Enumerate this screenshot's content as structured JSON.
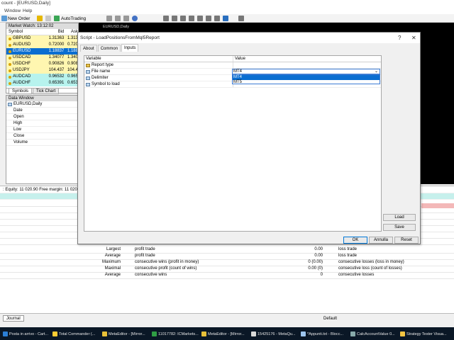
{
  "window": {
    "title": "count - [EURUSD,Daily]",
    "menu": [
      "Window",
      "Help"
    ]
  },
  "toolbar": {
    "new_order": "New Order",
    "auto_trading": "AutoTrading"
  },
  "market_watch": {
    "title": "Market Watch: 13:12:02",
    "col_symbol": "Symbol",
    "col_bid": "Bid",
    "col_ask": "Ask",
    "rows": [
      {
        "symbol": "GBPUSD",
        "bid": "1.31363",
        "ask": "1.313",
        "bg": "#fff6b0"
      },
      {
        "symbol": "AUDUSD",
        "bid": "0.72000",
        "ask": "0.720",
        "bg": "#fff6b0"
      },
      {
        "symbol": "EURUSD",
        "bid": "1.18837",
        "ask": "1.188",
        "bg": "#0a6ed1",
        "fg": "#ffffff"
      },
      {
        "symbol": "USDCAD",
        "bid": "1.34077",
        "ask": "1.340",
        "bg": "#fff6b0"
      },
      {
        "symbol": "USDCHF",
        "bid": "0.90826",
        "ask": "0.908",
        "bg": "#fff6b0"
      },
      {
        "symbol": "USDJPY",
        "bid": "104.437",
        "ask": "104.4",
        "bg": "#fff6b0"
      },
      {
        "symbol": "AUDCAD",
        "bid": "0.96532",
        "ask": "0.965",
        "bg": "#b7f3ee"
      },
      {
        "symbol": "AUDCHF",
        "bid": "0.65391",
        "ask": "0.653",
        "bg": "#b7f3ee"
      }
    ],
    "tabs": [
      "Symbols",
      "Tick Chart"
    ]
  },
  "data_window": {
    "title": "Data Window",
    "symbol": "EURUSD,Daily",
    "rows": [
      "Date",
      "Open",
      "High",
      "Low",
      "Close",
      "Volume"
    ]
  },
  "chart": {
    "label": "EURUSD,Daily"
  },
  "status": {
    "equity_line": ": Equity: 11 020.90  Free margin: 11 020.90"
  },
  "report": {
    "rows": [
      {
        "a": "Largest",
        "b": "profit trade",
        "c": "0.00",
        "d": "loss trade"
      },
      {
        "a": "Average",
        "b": "profit trade",
        "c": "0.00",
        "d": "loss trade"
      },
      {
        "a": "Maximum",
        "b": "consecutive wins (profit in money)",
        "c": "0 (0.00)",
        "d": "consecutive losses (loss in money)"
      },
      {
        "a": "Maximal",
        "b": "consecutive profit (count of wins)",
        "c": "0.00 (0)",
        "d": "consecutive loss (count of losses)"
      },
      {
        "a": "Average",
        "b": "consecutive wins",
        "c": "0",
        "d": "consecutive losses"
      }
    ]
  },
  "dialog": {
    "title": "Script - LoadPositionsFromMql5Report",
    "help": "?",
    "close": "✕",
    "tabs": [
      "About",
      "Common",
      "Inputs"
    ],
    "col_variable": "Variable",
    "col_value": "Value",
    "params": [
      {
        "name": "Report type",
        "value": "",
        "icon": "gear"
      },
      {
        "name": "File name",
        "value": "",
        "icon": "ab"
      },
      {
        "name": "Delimiter",
        "value": "",
        "icon": "ab"
      },
      {
        "name": "Symbol to load",
        "value": "",
        "icon": "ab"
      }
    ],
    "select_value": "MT4",
    "options": [
      "MT4",
      "MT5"
    ],
    "load_button": "Load",
    "save_button": "Save",
    "ok_button": "OK",
    "cancel_button": "Annulla",
    "reset_button": "Reset"
  },
  "bottom": {
    "journal_tab": "Journal",
    "status_default": "Default"
  },
  "taskbar": {
    "items": [
      {
        "label": "Posta in arrivo - Cart...",
        "color": "#2b7fd6"
      },
      {
        "label": "Total Commander (...",
        "color": "#ffcc33"
      },
      {
        "label": "MetaEditor - [Mirror...",
        "color": "#e8c038"
      },
      {
        "label": "11017782: ICMarkets...",
        "color": "#2f9e44"
      },
      {
        "label": "MetaEditor - [Mirror...",
        "color": "#e8c038"
      },
      {
        "label": "15425176 - MetaQu...",
        "color": "#d9d9d9"
      },
      {
        "label": "*Appunti.txt - Blocc...",
        "color": "#9ec6ef"
      },
      {
        "label": "CalcAccountValue 0...",
        "color": "#8aa"
      },
      {
        "label": "Strategy Tester Visua...",
        "color": "#f5c542"
      }
    ]
  },
  "colors": {
    "accent": "#0a6ed1",
    "chart_bg": "#000000",
    "taskbar": "#0a1726"
  }
}
